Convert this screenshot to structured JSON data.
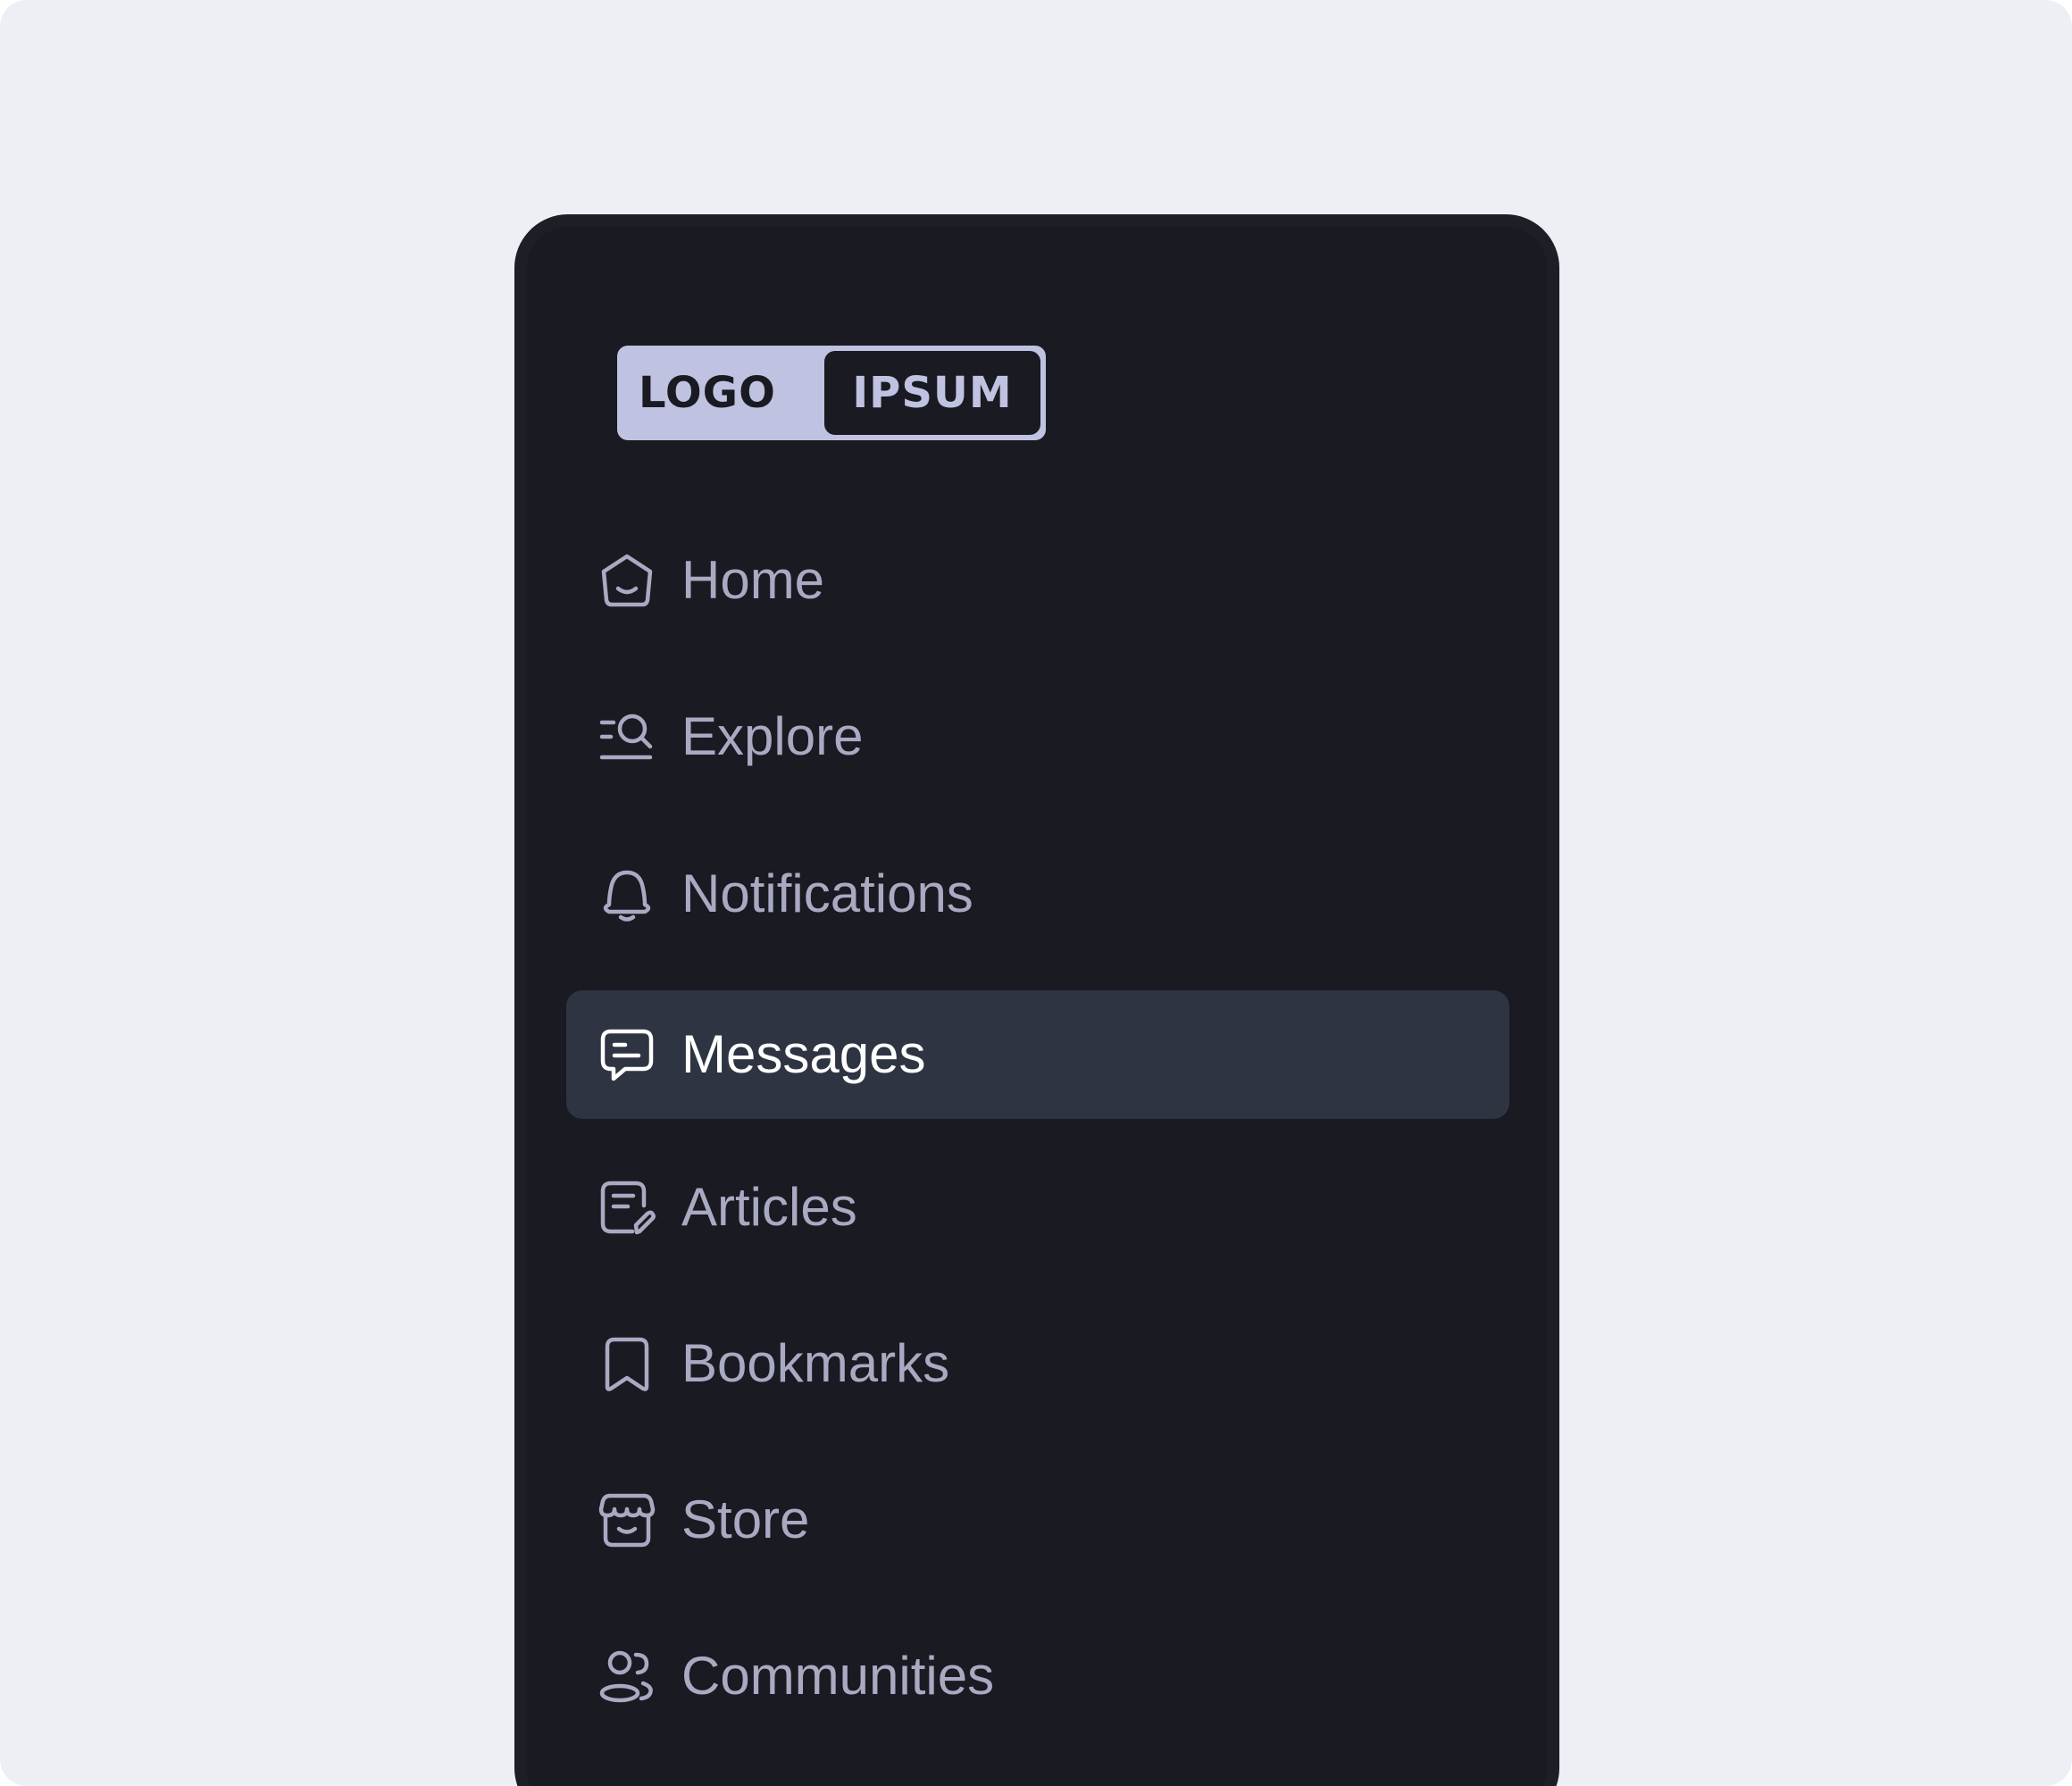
{
  "logo": {
    "left_text": "LOGO",
    "right_text": "IPSUM"
  },
  "nav": {
    "items": [
      {
        "label": "Home",
        "icon": "home-icon",
        "active": false
      },
      {
        "label": "Explore",
        "icon": "explore-icon",
        "active": false
      },
      {
        "label": "Notifications",
        "icon": "bell-icon",
        "active": false
      },
      {
        "label": "Messages",
        "icon": "message-icon",
        "active": true
      },
      {
        "label": "Articles",
        "icon": "article-edit-icon",
        "active": false
      },
      {
        "label": "Bookmarks",
        "icon": "bookmark-icon",
        "active": false
      },
      {
        "label": "Store",
        "icon": "store-icon",
        "active": false
      },
      {
        "label": "Communities",
        "icon": "users-icon",
        "active": false
      }
    ]
  },
  "colors": {
    "page_background": "#eceff4",
    "sidebar_background": "#191a22",
    "active_item_background": "#2f3443",
    "inactive_text": "#a8aac2",
    "active_text": "#ffffff",
    "logo_accent": "#bfc2e0"
  }
}
